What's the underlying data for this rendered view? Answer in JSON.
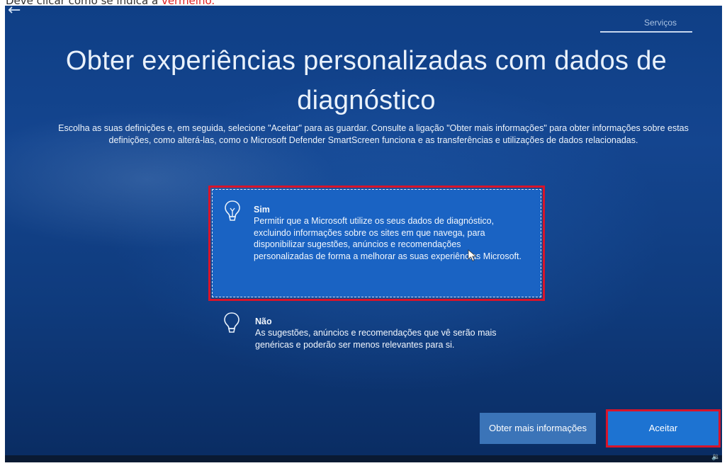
{
  "caption": {
    "text": "Deve clicar como se indica a ",
    "highlight": "vermelho."
  },
  "header": {
    "back_icon": "arrow-left-icon",
    "tab_label": "Serviços"
  },
  "page": {
    "title": "Obter experiências personalizadas com dados de diagnóstico",
    "description": "Escolha as suas definições e, em seguida, selecione \"Aceitar\" para as guardar. Consulte a ligação \"Obter mais informações\" para obter informações sobre estas definições, como alterá-las, como o Microsoft Defender SmartScreen funciona e as transferências e utilizações de dados relacionadas."
  },
  "options": [
    {
      "title": "Sim",
      "body": "Permitir que a Microsoft utilize os seus dados de diagnóstico, excluindo informações sobre os sites em que navega, para disponibilizar sugestões, anúncios e recomendações personalizadas de forma a melhorar as suas experiências Microsoft.",
      "icon": "lightbulb-on-icon",
      "selected": true
    },
    {
      "title": "Não",
      "body": "As sugestões, anúncios e recomendações que vê serão mais genéricas e poderão ser menos relevantes para si.",
      "icon": "lightbulb-off-icon",
      "selected": false
    }
  ],
  "buttons": {
    "more_info": "Obter mais informações",
    "accept": "Aceitar"
  },
  "colors": {
    "background": "#14458f",
    "selected_option": "#1a63c3",
    "accept_button": "#1d73d2",
    "annotation_red": "#d8142a"
  }
}
